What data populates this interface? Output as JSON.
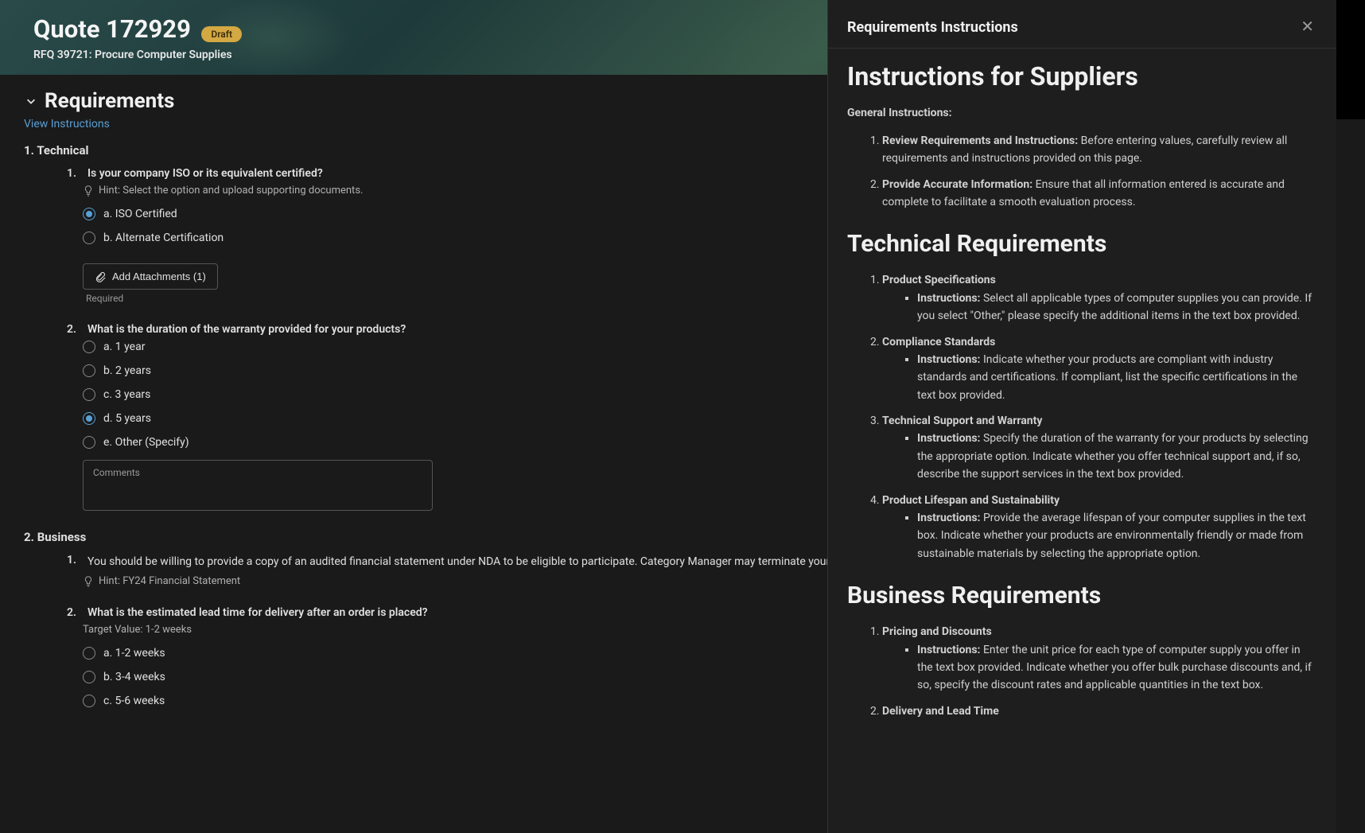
{
  "header": {
    "title": "Quote 172929",
    "status": "Draft",
    "subtitle": "RFQ 39721: Procure Computer Supplies"
  },
  "section": {
    "title": "Requirements",
    "view_instructions": "View Instructions"
  },
  "subsections": [
    {
      "num": "1.",
      "title": "Technical",
      "questions": [
        {
          "num": "1.",
          "text": "Is your company ISO or its equivalent certified?",
          "hint": "Hint: Select the option and upload supporting documents.",
          "options": [
            {
              "letter": "a.",
              "label": "ISO Certified",
              "checked": true
            },
            {
              "letter": "b.",
              "label": "Alternate Certification",
              "checked": false
            }
          ],
          "attachments_label": "Add Attachments (1)",
          "required_label": "Required"
        },
        {
          "num": "2.",
          "text": "What is the duration of the warranty provided for your products?",
          "options": [
            {
              "letter": "a.",
              "label": "1 year",
              "checked": false
            },
            {
              "letter": "b.",
              "label": "2 years",
              "checked": false
            },
            {
              "letter": "c.",
              "label": "3 years",
              "checked": false
            },
            {
              "letter": "d.",
              "label": "5 years",
              "checked": true
            },
            {
              "letter": "e.",
              "label": "Other (Specify)",
              "checked": false
            }
          ],
          "comments_label": "Comments"
        }
      ]
    },
    {
      "num": "2.",
      "title": "Business",
      "questions": [
        {
          "num": "1.",
          "text_long": "You should be willing to provide a copy of an audited financial statement under NDA to be eligible to participate. Category Manager may terminate your participation in RFQ if a breach of agreement is determined.",
          "hint": "Hint: FY24 Financial Statement"
        },
        {
          "num": "2.",
          "text": "What is the estimated lead time for delivery after an order is placed?",
          "target": "Target Value: 1-2 weeks",
          "options": [
            {
              "letter": "a.",
              "label": "1-2 weeks",
              "checked": false
            },
            {
              "letter": "b.",
              "label": "3-4 weeks",
              "checked": false
            },
            {
              "letter": "c.",
              "label": "5-6 weeks",
              "checked": false
            }
          ]
        }
      ]
    }
  ],
  "panel": {
    "header": "Requirements Instructions",
    "h1": "Instructions for Suppliers",
    "general_label": "General Instructions:",
    "general": [
      {
        "bold": "Review Requirements and Instructions:",
        "text": " Before entering values, carefully review all requirements and instructions provided on this page."
      },
      {
        "bold": "Provide Accurate Information:",
        "text": " Ensure that all information entered is accurate and complete to facilitate a smooth evaluation process."
      }
    ],
    "tech_title": "Technical Requirements",
    "tech": [
      {
        "title": "Product Specifications",
        "instr": "Instructions:",
        "text": " Select all applicable types of computer supplies you can provide. If you select \"Other,\" please specify the additional items in the text box provided."
      },
      {
        "title": "Compliance Standards",
        "instr": "Instructions:",
        "text": " Indicate whether your products are compliant with industry standards and certifications. If compliant, list the specific certifications in the text box provided."
      },
      {
        "title": "Technical Support and Warranty",
        "instr": "Instructions:",
        "text": " Specify the duration of the warranty for your products by selecting the appropriate option. Indicate whether you offer technical support and, if so, describe the support services in the text box provided."
      },
      {
        "title": "Product Lifespan and Sustainability",
        "instr": "Instructions:",
        "text": " Provide the average lifespan of your computer supplies in the text box. Indicate whether your products are environmentally friendly or made from sustainable materials by selecting the appropriate option."
      }
    ],
    "biz_title": "Business Requirements",
    "biz": [
      {
        "title": "Pricing and Discounts",
        "instr": "Instructions:",
        "text": " Enter the unit price for each type of computer supply you offer in the text box provided. Indicate whether you offer bulk purchase discounts and, if so, specify the discount rates and applicable quantities in the text box."
      },
      {
        "title": "Delivery and Lead Time"
      }
    ]
  }
}
